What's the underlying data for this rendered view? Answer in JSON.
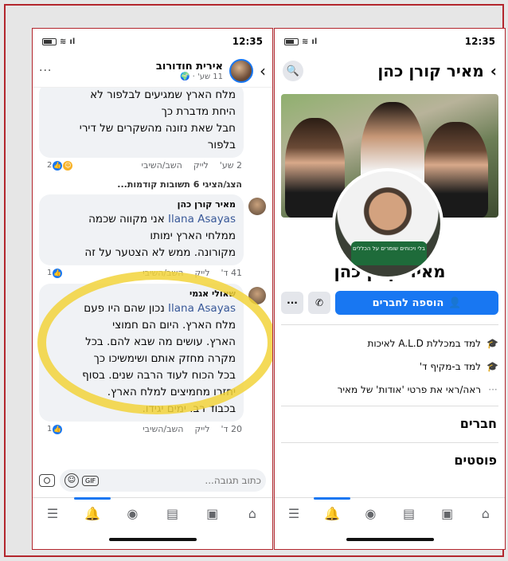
{
  "left": {
    "status": {
      "time": "12:35"
    },
    "header": {
      "name": "אירית חודורוב",
      "sub": "11 שע' · 🌍"
    },
    "comments": [
      {
        "text_lines": [
          "מלח הארץ שמגיעים לבלפור לא",
          "היחת מדברת כך",
          "חבל שאת נזונה מהשקרים של דירי",
          "בלפור"
        ],
        "time": "2 שע'",
        "like": "לייק",
        "reply": "השב/השיבי",
        "reactions": "2"
      },
      {
        "more": "הצג/הציגי 6 תשובות קודמות..."
      },
      {
        "name": "מאיר קורן כהן",
        "mention": "Ilana Asayas",
        "text_lines": [
          "אני מקווה שכמה",
          "ממלחי הארץ ימותו",
          "מקורונה. ממש לא הצטער על זה"
        ],
        "time": "41 ד'",
        "like": "לייק",
        "reply": "השב/השיבי",
        "reactions": "1"
      },
      {
        "name": "שאולי אגמי",
        "mention": "Ilana Asayas",
        "text_lines": [
          "נכון שהם היו פעם",
          "מלח הארץ. היום הם חמוצי",
          "הארץ. עושים מה שבא להם. בכל",
          "מקרה מחזק אותם ושימשיכו כך",
          "בכל הכוח לעוד הרבה שנים. בסוף",
          "יחזרו מחמיצים למלח הארץ.",
          "בכבוד רב. ימים יגידו."
        ],
        "time": "20 ד'",
        "like": "לייק",
        "reply": "השב/השיבי",
        "reactions": "1"
      }
    ],
    "compose": {
      "placeholder": "כתוב תגובה...",
      "gif": "GIF"
    }
  },
  "right": {
    "status": {
      "time": "12:35"
    },
    "title": "מאיר קורן כהן",
    "badge_text": "בלי ויכוחים\nשומרים על הכללים",
    "name": "מאיר קורן כהן",
    "add_friend": "הוספה לחברים",
    "more_btn": "···",
    "info": [
      {
        "icon": "🎓",
        "text": "למד במכללת A.L.D לאיכות"
      },
      {
        "icon": "🎓",
        "text": "למד ב-מקיף ד'"
      },
      {
        "icon": "···",
        "text": "ראה/ראי את פרטי 'אודות' של מאיר"
      }
    ],
    "friends_label": "חברים",
    "posts_label": "פוסטים"
  },
  "colors": {
    "accent": "#1877f2",
    "highlight": "#f2d33b",
    "frame": "#b3262d"
  }
}
